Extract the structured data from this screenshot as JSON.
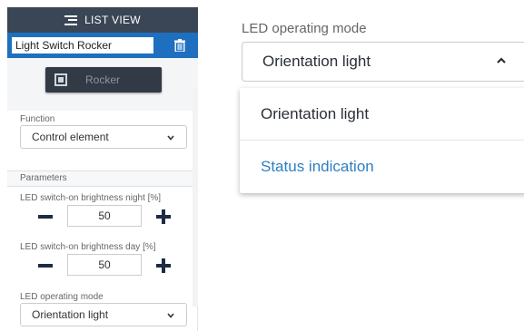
{
  "list_view": {
    "title": "LIST VIEW",
    "icon": "list-icon"
  },
  "device": {
    "name_value": "Light Switch Rocker",
    "delete_icon": "trash-icon"
  },
  "rocker": {
    "label": "Rocker",
    "icon": "rocker-switch-icon"
  },
  "function": {
    "label": "Function",
    "selected": "Control element"
  },
  "parameters": {
    "section_label": "Parameters",
    "brightness_night": {
      "label": "LED switch-on brightness night [%]",
      "value": "50"
    },
    "brightness_day": {
      "label": "LED switch-on brightness day [%]",
      "value": "50"
    },
    "led_mode": {
      "label": "LED operating mode",
      "selected": "Orientation light"
    }
  },
  "zoom": {
    "label": "LED operating mode",
    "selected": "Orientation light",
    "options": [
      "Orientation light",
      "Status indication"
    ]
  },
  "colors": {
    "header_bg": "#3a4656",
    "accent_blue": "#1e6fbf",
    "link_blue": "#2d7fc1",
    "stepper_dark": "#1d2b44"
  }
}
